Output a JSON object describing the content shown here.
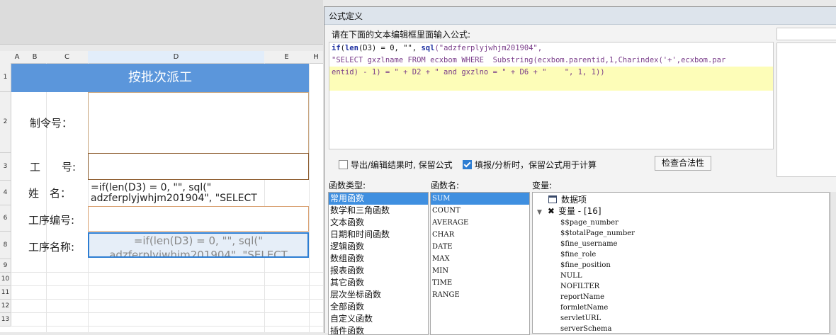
{
  "sheet": {
    "columns": [
      "A",
      "B",
      "C",
      "D",
      "E",
      "H"
    ],
    "rows": [
      "1",
      "2",
      "3",
      "4",
      "6",
      "8",
      "9",
      "10",
      "11",
      "12",
      "13"
    ],
    "banner": "按批次派工",
    "labels": {
      "order_no": "制令号：",
      "work_no": "工　　号:",
      "name": "姓　名：",
      "process_no": "工序编号:",
      "process_name": "工序名称:"
    },
    "formula_row4_line1": "=if(len(D3) = 0, \"\", sql(\"",
    "formula_row4_line2": "adzferplyjwhjm201904\", \"SELECT",
    "formula_row8_line1": "=if(len(D3) = 0, \"\", sql(\"",
    "formula_row8_line2": "adzferplyjwhjm201904\", \"SELECT"
  },
  "dialog": {
    "title": "公式定义",
    "instruction": "请在下面的文本编辑框里面输入公式:",
    "code": {
      "line1_kw1": "if",
      "line1_p1": "(",
      "line1_kw2": "len",
      "line1_p2": "(D3) = 0, \"\", ",
      "line1_kw3": "sql",
      "line1_p3": "(\"adzferplyjwhjm201904\",",
      "line2": "\"SELECT gxzlname FROM ecxbom WHERE  Substring(ecxbom.parentid,1,Charindex('+',ecxbom.par",
      "line3": "entid) - 1) = \" + D2 + \" and gxzlno = \" + D6 + \"    \", 1, 1))"
    },
    "option_keep_export": "导出/编辑结果时, 保留公式",
    "option_keep_fill": "填报/分析时，保留公式用于计算",
    "option_keep_fill_checked": true,
    "check_button": "检查合法性",
    "func_type_header": "函数类型:",
    "func_name_header": "函数名:",
    "var_header": "变量:",
    "func_types": [
      "常用函数",
      "数学和三角函数",
      "文本函数",
      "日期和时间函数",
      "逻辑函数",
      "数组函数",
      "报表函数",
      "其它函数",
      "层次坐标函数",
      "全部函数",
      "自定义函数",
      "插件函数"
    ],
    "func_names": [
      "SUM",
      "COUNT",
      "AVERAGE",
      "CHAR",
      "DATE",
      "MAX",
      "MIN",
      "TIME",
      "RANGE"
    ],
    "var_data_item": "数据项",
    "var_group": "变量 - [16]",
    "variables": [
      "$$page_number",
      "$$totalPage_number",
      "$fine_username",
      "$fine_role",
      "$fine_position",
      "NULL",
      "NOFILTER",
      "reportName",
      "formletName",
      "servletURL",
      "serverSchema"
    ]
  }
}
